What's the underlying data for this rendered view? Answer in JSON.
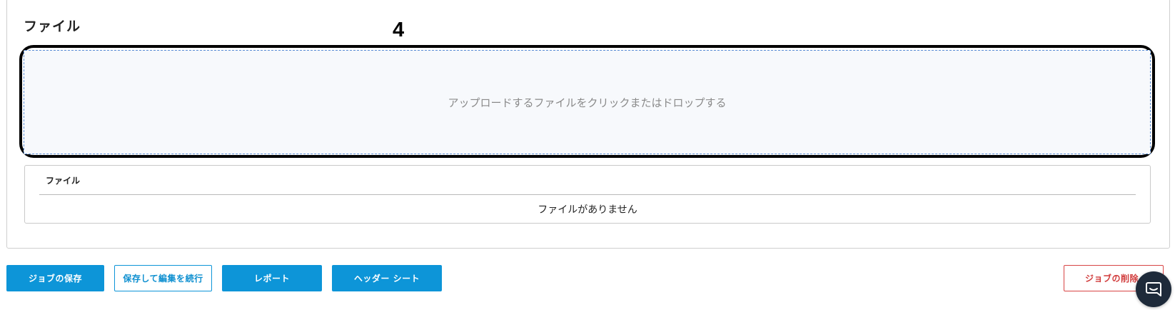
{
  "files_section": {
    "title": "ファイル",
    "step_number": "4",
    "dropzone_text": "アップロードするファイルをクリックまたはドロップする",
    "table": {
      "column_header": "ファイル",
      "empty_message": "ファイルがありません"
    }
  },
  "actions": {
    "save_job": "ジョブの保存",
    "save_and_continue": "保存して編集を続行",
    "report": "レポート",
    "header_sheet": "ヘッダー シート",
    "delete_job": "ジョブの削除"
  },
  "chat": {
    "icon": "chat-bubble-icon"
  },
  "colors": {
    "primary": "#0d95d8",
    "danger": "#d84545",
    "dropzone_border": "#5b8ed6",
    "chat_bg": "#1e2a3a"
  }
}
